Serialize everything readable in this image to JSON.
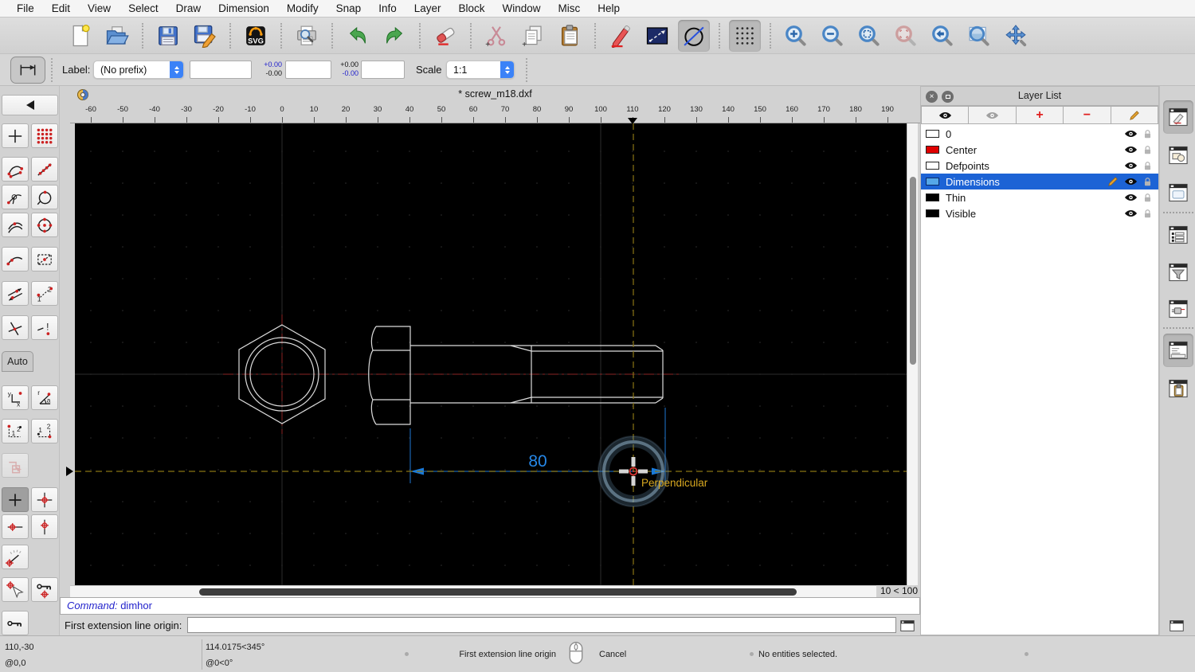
{
  "menu_bar": {
    "items": [
      "File",
      "Edit",
      "View",
      "Select",
      "Draw",
      "Dimension",
      "Modify",
      "Snap",
      "Info",
      "Layer",
      "Block",
      "Window",
      "Misc",
      "Help"
    ]
  },
  "main_toolbar": {
    "groups": [
      [
        "new-file",
        "open-file"
      ],
      [
        "save",
        "save-as"
      ],
      [
        "svg-export"
      ],
      [
        "print-preview"
      ],
      [
        "undo",
        "redo"
      ],
      [
        "eraser"
      ],
      [
        "cut",
        "copy",
        "paste"
      ],
      [
        "pen-edit",
        "line-tool",
        "circle-tool"
      ],
      [
        "grid-toggle"
      ],
      [
        "zoom-in",
        "zoom-out",
        "zoom-auto",
        "zoom-previous",
        "zoom-back",
        "zoom-window",
        "zoom-pan"
      ]
    ],
    "pressed": [
      "circle-tool",
      "grid-toggle"
    ],
    "disabled": [
      "zoom-previous"
    ]
  },
  "options_toolbar": {
    "tool_icon": "dimension-horizontal",
    "label_text": "Label:",
    "prefix_value": "(No prefix)",
    "label_value": "",
    "tol1_top": "+0.00",
    "tol1_bottom": "-0.00",
    "tol2_top": "+0.00",
    "tol2_bottom": "-0.00",
    "scale_text": "Scale",
    "scale_value": "1:1"
  },
  "snap_toolbar": {
    "auto_label": "Auto",
    "icons": [
      "snap-free",
      "snap-grid",
      "snap-endpoints",
      "snap-on-entity",
      "snap-nearest",
      "snap-entity",
      "snap-middle",
      "snap-center",
      "snap-distance",
      "snap-intersection",
      "restrict-angle-1",
      "restrict-angle-2",
      "intersection-manual",
      "snap-nothing",
      "coordinate-cartesian",
      "coordinate-polar",
      "order-corner-1",
      "order-corner-2",
      "selection-tool",
      "crosshair-tool",
      "set-relative-zero",
      "restrict-horizontal",
      "restrict-vertical",
      "angle-gauge",
      "snap-relative-zero",
      "lock-relative-zero",
      "relative-zero-key"
    ],
    "pressed": [
      "crosshair-tool"
    ],
    "disabled": [
      "selection-tool"
    ]
  },
  "document": {
    "tab_title": "* screw_m18.dxf",
    "ruler": {
      "labels": [
        "-60",
        "-50",
        "-40",
        "-30",
        "-20",
        "-10",
        "0",
        "10",
        "20",
        "30",
        "40",
        "50",
        "60",
        "70",
        "80",
        "90",
        "100",
        "110",
        "120",
        "130",
        "140",
        "150",
        "160",
        "170",
        "180",
        "190"
      ],
      "marker_value": "110"
    },
    "grid_status": "10 < 100"
  },
  "canvas": {
    "dimension_label": "80",
    "snap_hint": "Perpendicular",
    "colors": {
      "dimension_line": "#1a64b0",
      "dimension_arrow": "#1a7ad8",
      "dimension_text": "#2688e8",
      "centerline": "#8b2525",
      "guide_crosshair": "#8a7514",
      "tooltip_text": "#d8a820",
      "geometry": "#dcdcdc",
      "snap_glow": "#7d9db8"
    }
  },
  "layer_panel": {
    "title": "Layer List",
    "add_label": "+",
    "remove_label": "−",
    "layers": [
      {
        "name": "0",
        "color": "#ffffff",
        "selected": false,
        "editing": false
      },
      {
        "name": "Center",
        "color": "#e00000",
        "selected": false,
        "editing": false
      },
      {
        "name": "Defpoints",
        "color": "#ffffff",
        "selected": false,
        "editing": false
      },
      {
        "name": "Dimensions",
        "color": "#55a7e8",
        "selected": true,
        "editing": true
      },
      {
        "name": "Thin",
        "color": "#000000",
        "selected": false,
        "editing": false
      },
      {
        "name": "Visible",
        "color": "#000000",
        "selected": false,
        "editing": false
      }
    ]
  },
  "right_dock": {
    "icons": [
      "dock-pen-palette",
      "dock-block-list",
      "dock-library-browser",
      "dock-widget-list",
      "dock-entity-filter",
      "dock-plugins",
      "dock-command-line",
      "dock-clipboard"
    ],
    "pressed": [
      "dock-pen-palette",
      "dock-command-line"
    ]
  },
  "command": {
    "history_label": "Command:",
    "history_value": "dimhor",
    "prompt_label": "First extension line origin:",
    "prompt_value": ""
  },
  "status": {
    "abs_coord": "110,-30",
    "rel_coord": "@0,0",
    "polar_abs": "114.0175<345°",
    "polar_rel": "@0<0°",
    "left_hint": "First extension line origin",
    "right_hint": "Cancel",
    "selection_status": "No entities selected."
  }
}
